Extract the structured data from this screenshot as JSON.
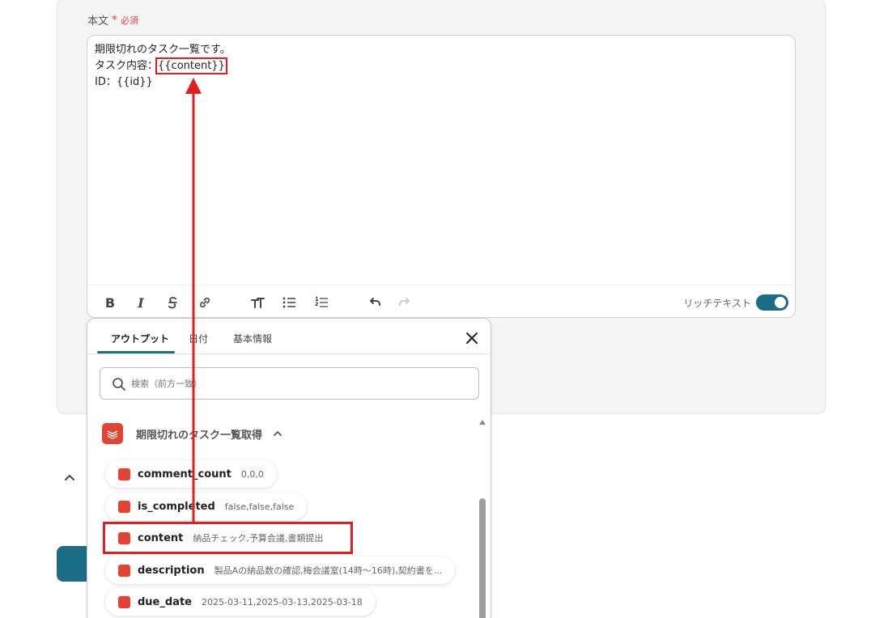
{
  "field": {
    "label": "本文",
    "required_star": "*",
    "required_text": "必須"
  },
  "editor": {
    "lines": [
      "期限切れのタスク一覧です。",
      "タスク内容：",
      "{{content}}",
      "ID：{{id}}"
    ],
    "rich_text_label": "リッチテキスト",
    "rich_text_enabled": true
  },
  "toolbar": {
    "bold_label": "B",
    "italic_label": "I"
  },
  "popup": {
    "tabs": [
      {
        "label": "アウトプット",
        "active": true
      },
      {
        "label": "日付",
        "active": false
      },
      {
        "label": "基本情報",
        "active": false
      }
    ],
    "search_placeholder": "検索（前方一致）",
    "section_title": "期限切れのタスク一覧取得",
    "items": [
      {
        "key": "comment_count",
        "value": "0,0,0"
      },
      {
        "key": "is_completed",
        "value": "false,false,false"
      },
      {
        "key": "content",
        "value": "納品チェック,予算会議,書類提出"
      },
      {
        "key": "description",
        "value": "製品Aの納品数の確認,梅会議室(14時〜16時),契約書を..."
      },
      {
        "key": "due_date",
        "value": "2025-03-11,2025-03-13,2025-03-18"
      }
    ]
  },
  "colors": {
    "accent": "#1c6d86",
    "required": "#e8474f",
    "todoist": "#e44332",
    "annotation": "#e02020"
  }
}
